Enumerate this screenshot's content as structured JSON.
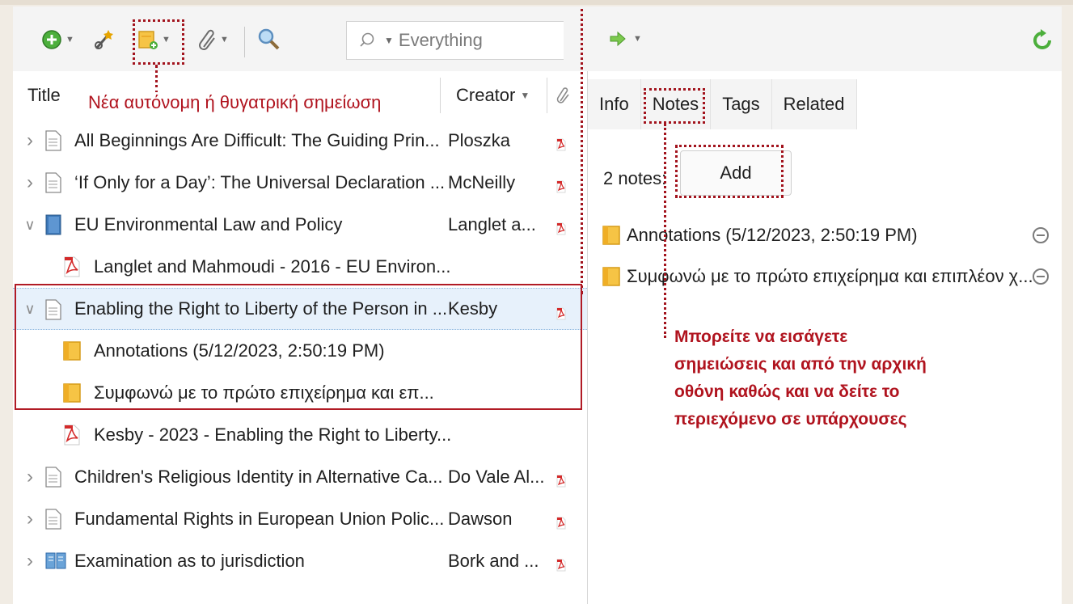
{
  "toolbar": {
    "search_mode": "Everything",
    "icons": [
      "new-item-icon",
      "magic-wand-icon",
      "new-note-icon",
      "attachment-icon",
      "search-magnifier-icon",
      "locate-arrow-icon",
      "sync-icon"
    ]
  },
  "columns": {
    "title": "Title",
    "creator": "Creator"
  },
  "items": [
    {
      "title": "All Beginnings Are Difficult: The Guiding Prin...",
      "creator": "Ploszka",
      "type": "document",
      "expander": "collapsed",
      "pdf": true
    },
    {
      "title": "‘If Only for a Day’: The Universal Declaration ...",
      "creator": "McNeilly",
      "type": "document",
      "expander": "collapsed",
      "pdf": true
    },
    {
      "title": "EU Environmental Law and Policy",
      "creator": "Langlet a...",
      "type": "book",
      "expander": "expanded",
      "pdf": true
    },
    {
      "title": "Langlet and Mahmoudi - 2016 - EU Environ...",
      "creator": "",
      "type": "pdf-attachment",
      "expander": "none",
      "pdf": false
    },
    {
      "title": "Enabling the Right to Liberty of the Person in ...",
      "creator": "Kesby",
      "type": "document",
      "expander": "expanded",
      "pdf": true,
      "selected": true
    },
    {
      "title": "Annotations (5/12/2023, 2:50:19 PM)",
      "creator": "",
      "type": "note",
      "expander": "none",
      "pdf": false
    },
    {
      "title": "Συμφωνώ με το πρώτο επιχείρημα και επ...",
      "creator": "",
      "type": "note",
      "expander": "none",
      "pdf": false
    },
    {
      "title": "Kesby - 2023 - Enabling the Right to Liberty...",
      "creator": "",
      "type": "pdf-attachment",
      "expander": "none",
      "pdf": false
    },
    {
      "title": "Children's Religious Identity in Alternative Ca...",
      "creator": "Do Vale Al...",
      "type": "document",
      "expander": "collapsed",
      "pdf": true
    },
    {
      "title": "Fundamental Rights in European Union Polic...",
      "creator": "Dawson",
      "type": "document",
      "expander": "collapsed",
      "pdf": true
    },
    {
      "title": "Examination as to jurisdiction",
      "creator": "Bork and ...",
      "type": "book-section",
      "expander": "collapsed",
      "pdf": true
    }
  ],
  "right_pane": {
    "tabs": [
      "Info",
      "Notes",
      "Tags",
      "Related"
    ],
    "active_tab": "Notes",
    "notes_count": "2 notes:",
    "add_label": "Add",
    "notes": [
      "Annotations (5/12/2023, 2:50:19 PM)",
      "Συμφωνώ με το πρώτο επιχείρημα και επιπλέον χ..."
    ]
  },
  "annotations": {
    "toolbar_note": "Νέα αυτόνομη ή θυγατρική σημείωση",
    "info_lines": [
      "Μπορείτε να εισάγετε",
      "σημειώσεις και από την αρχική",
      "οθόνη καθώς και να δείτε το",
      "περιεχόμενο σε υπάρχουσες"
    ],
    "color": "#b0131e"
  }
}
